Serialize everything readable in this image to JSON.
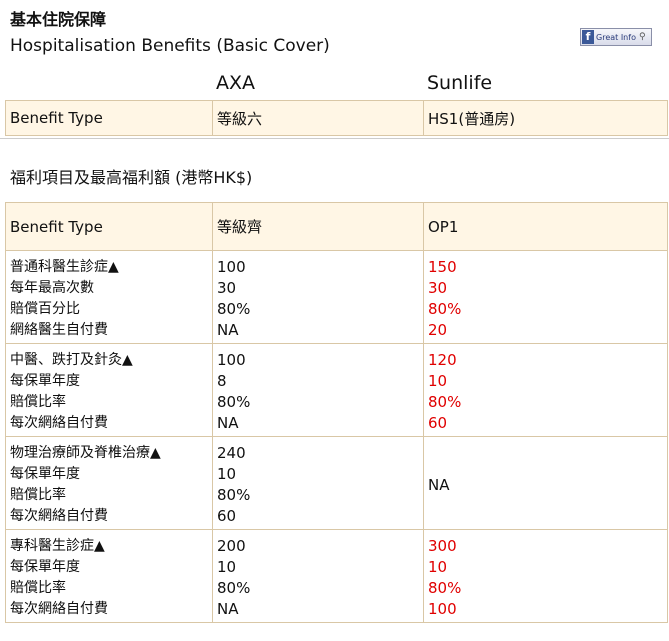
{
  "header": {
    "title_cn": "基本住院保障",
    "title_en": "Hospitalisation Benefits (Basic Cover)",
    "badge": {
      "icon": "facebook-icon",
      "label": "Great Info"
    }
  },
  "companies": [
    "AXA",
    "Sunlife"
  ],
  "plan_row": {
    "label": "Benefit Type",
    "axa": "等級六",
    "sunlife": "HS1(普通房)"
  },
  "section_title": "福利項目及最高福利額 (港幣HK$)",
  "table_header": {
    "label": "Benefit Type",
    "axa": "等級齊",
    "sunlife": "OP1"
  },
  "colors": {
    "header_bg": "#fff6e5",
    "border": "#d9c7a6",
    "highlight": "#e00000"
  },
  "blocks": [
    {
      "labels": [
        "普通科醫生診症▲",
        "每年最高次數",
        "賠償百分比",
        "網絡醫生自付費"
      ],
      "axa": [
        "100",
        "30",
        "80%",
        "NA"
      ],
      "sunlife": [
        "150",
        "30",
        "80%",
        "20"
      ]
    },
    {
      "labels": [
        "中醫、跌打及針灸▲",
        "每保單年度",
        "賠償比率",
        "每次網絡自付費"
      ],
      "axa": [
        "100",
        "8",
        "80%",
        "NA"
      ],
      "sunlife": [
        "120",
        "10",
        "80%",
        "60"
      ]
    },
    {
      "labels": [
        "物理治療師及脊椎治療▲",
        "每保單年度",
        "賠償比率",
        "每次網絡自付費"
      ],
      "axa": [
        "240",
        "10",
        "80%",
        "60"
      ],
      "sunlife_na": "NA"
    },
    {
      "labels": [
        "專科醫生診症▲",
        "每保單年度",
        "賠償比率",
        "每次網絡自付費"
      ],
      "axa": [
        "200",
        "10",
        "80%",
        "NA"
      ],
      "sunlife": [
        "300",
        "10",
        "80%",
        "100"
      ]
    }
  ]
}
